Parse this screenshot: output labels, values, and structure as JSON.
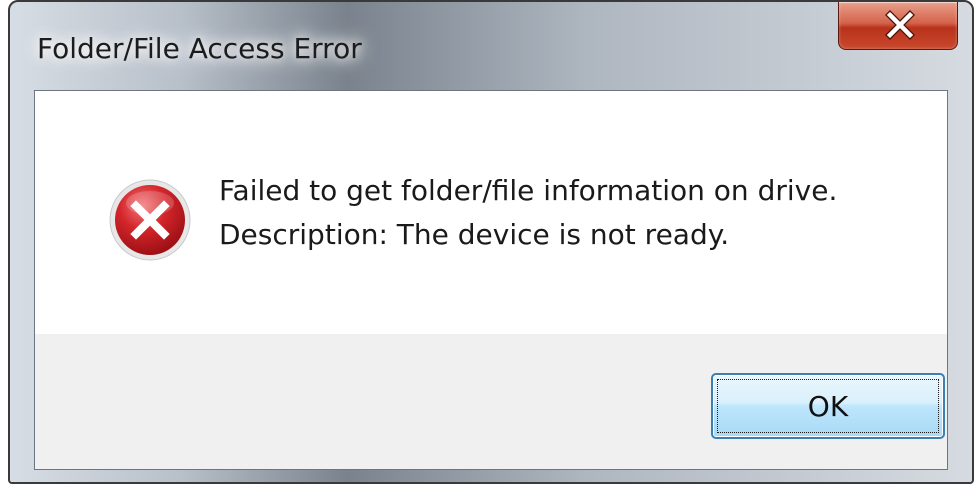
{
  "window": {
    "title": "Folder/File Access Error"
  },
  "titlebar": {
    "close_icon": "close-x-icon",
    "close_color": "#c9482c"
  },
  "dialog": {
    "icon": "error-icon",
    "icon_color": "#c4141b",
    "message_line1": "Failed to get folder/file information on drive.",
    "message_line2": "Description: The device is not ready.",
    "ok_label": "OK"
  }
}
